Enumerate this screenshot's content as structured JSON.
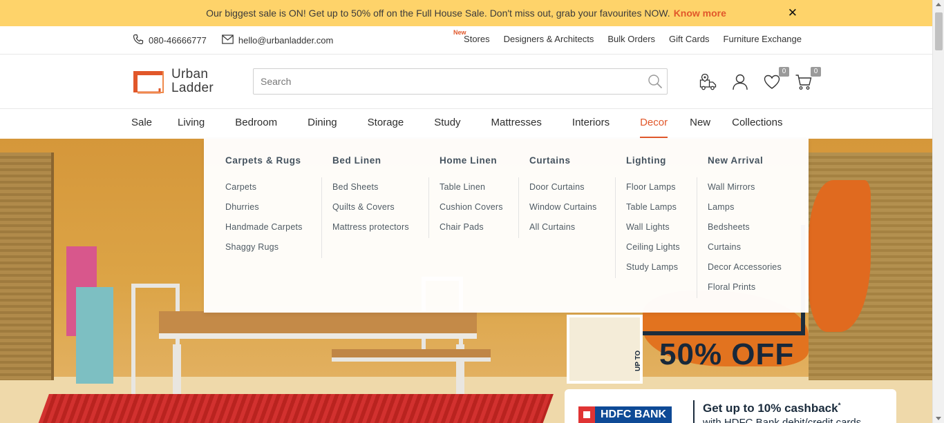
{
  "promo": {
    "message": "Our biggest sale is ON! Get up to 50% off on the Full House Sale. Don't miss out, grab your favourites NOW.",
    "link": "Know more",
    "close": "✕"
  },
  "utility": {
    "phone": "080-46666777",
    "email": "hello@urbanladder.com",
    "links": [
      {
        "label": "Stores",
        "badge": "New"
      },
      {
        "label": "Designers & Architects"
      },
      {
        "label": "Bulk Orders"
      },
      {
        "label": "Gift Cards"
      },
      {
        "label": "Furniture Exchange"
      }
    ]
  },
  "header": {
    "logo_line1": "Urban",
    "logo_line2": "Ladder",
    "search_placeholder": "Search",
    "wishlist_count": "0",
    "cart_count": "0",
    "brand_color": "#e1572a"
  },
  "nav": {
    "items": [
      "Sale",
      "Living",
      "Bedroom",
      "Dining",
      "Storage",
      "Study",
      "Mattresses",
      "Interiors",
      "Decor",
      "New",
      "Collections"
    ],
    "active": "Decor"
  },
  "dropdown": {
    "columns": [
      {
        "title": "Carpets & Rugs",
        "items": [
          "Carpets",
          "Dhurries",
          "Handmade Carpets",
          "Shaggy Rugs"
        ]
      },
      {
        "title": "Bed Linen",
        "items": [
          "Bed Sheets",
          "Quilts & Covers",
          "Mattress protectors"
        ]
      },
      {
        "title": "Home Linen",
        "items": [
          "Table Linen",
          "Cushion Covers",
          "Chair Pads"
        ]
      },
      {
        "title": "Curtains",
        "items": [
          "Door Curtains",
          "Window Curtains",
          "All Curtains"
        ]
      },
      {
        "title": "Lighting",
        "items": [
          "Floor Lamps",
          "Table Lamps",
          "Wall Lights",
          "Ceiling Lights",
          "Study Lamps"
        ]
      },
      {
        "title": "New Arrival",
        "items": [
          "Wall Mirrors",
          "Lamps",
          "Bedsheets",
          "Curtains",
          "Decor Accessories",
          "Floral Prints"
        ]
      }
    ]
  },
  "hero": {
    "upto": "UP TO",
    "offer": "50% OFF",
    "bank_name": "HDFC BANK",
    "cashback": "Get up to 10% cashback",
    "cashback_mark": "*",
    "cashback_sub": "with HDFC Bank debit/credit cards"
  }
}
